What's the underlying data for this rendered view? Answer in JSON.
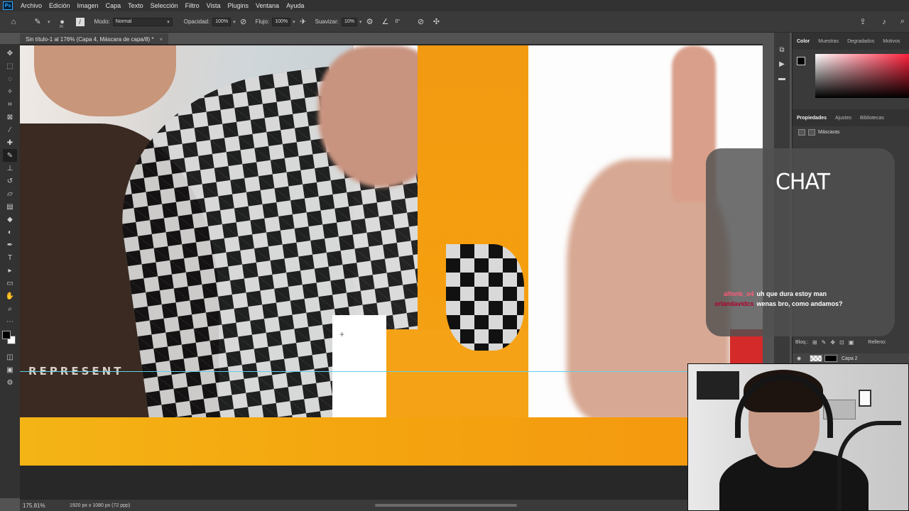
{
  "app": {
    "logo": "Ps"
  },
  "menubar": {
    "items": [
      "Archivo",
      "Edición",
      "Imagen",
      "Capa",
      "Texto",
      "Selección",
      "Filtro",
      "Vista",
      "Plugins",
      "Ventana",
      "Ayuda"
    ]
  },
  "options": {
    "brush_size": "26",
    "mode_label": "Modo:",
    "mode_value": "Normal",
    "opacity_label": "Opacidad:",
    "opacity_value": "100%",
    "flow_label": "Flujo:",
    "flow_value": "100%",
    "smooth_label": "Suavizar:",
    "smooth_value": "10%",
    "angle_value": "0°"
  },
  "document": {
    "tab_title": "Sin título-1 al 176% (Capa 4, Máscara de capa/8) *",
    "close_glyph": "×"
  },
  "canvas": {
    "tshirt_text": "REPRESENT"
  },
  "status": {
    "zoom": "175.81%",
    "doc_info": "1920 px x 1080 px (72 ppp)"
  },
  "color_panel": {
    "tabs": [
      "Color",
      "Muestras",
      "Degradados",
      "Motivos"
    ]
  },
  "properties_panel": {
    "tabs": [
      "Propiedades",
      "Ajustes",
      "Bibliotecas"
    ],
    "masks_label": "Máscaras"
  },
  "layers_panel": {
    "lock_label": "Bloq.:",
    "fill_label": "Relleno:",
    "layer_name": "Capa 2"
  },
  "chat": {
    "title": "CHAT",
    "messages": [
      {
        "user": "alfonb_o4",
        "text": "uh que dura estoy man"
      },
      {
        "user": "orlandavidcs",
        "text": "wenas bro, como andamos?"
      }
    ]
  },
  "icons": {
    "home": "home-icon",
    "brush": "brush-icon",
    "settings": "gear-icon",
    "share": "share-icon",
    "bell": "bell-icon"
  }
}
